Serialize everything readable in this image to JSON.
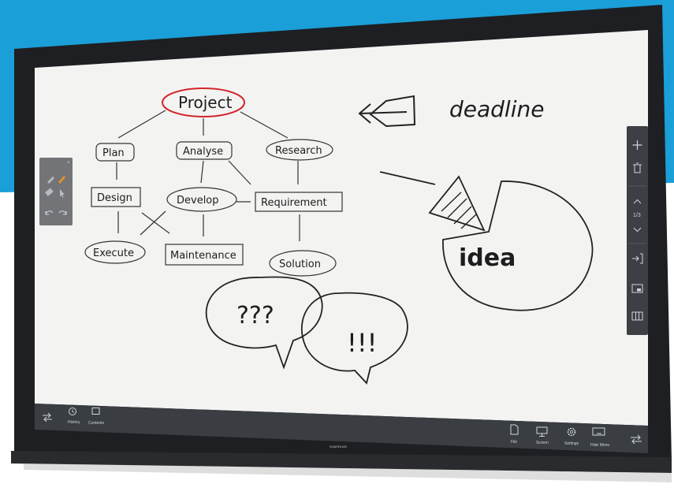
{
  "bottom_bar": {
    "history_label": "History",
    "contents_label": "Contents",
    "file_label": "File",
    "screen_label": "Screen",
    "settings_label": "Settings",
    "hide_menu_label": "Hide Menu"
  },
  "right_toolbar": {
    "page_indicator": "1/3"
  },
  "bezel": {
    "brand": "SAMSUNG"
  },
  "whiteboard": {
    "center_node": "Project",
    "nodes_row1": [
      "Plan",
      "Analyse",
      "Research"
    ],
    "nodes_row2": [
      "Design",
      "Develop",
      "Requirement"
    ],
    "nodes_row3": [
      "Execute",
      "Maintenance",
      "Solution"
    ],
    "deadline_text": "deadline",
    "idea_text": "idea",
    "bubble_left_text": "???",
    "bubble_right_text": "!!!"
  },
  "colors": {
    "sky_blue": "#1a9fd8",
    "bezel": "#1e1f22",
    "board": "#f3f4f2",
    "toolbar": "#3c3f44",
    "highlight_red": "#d3252b"
  }
}
